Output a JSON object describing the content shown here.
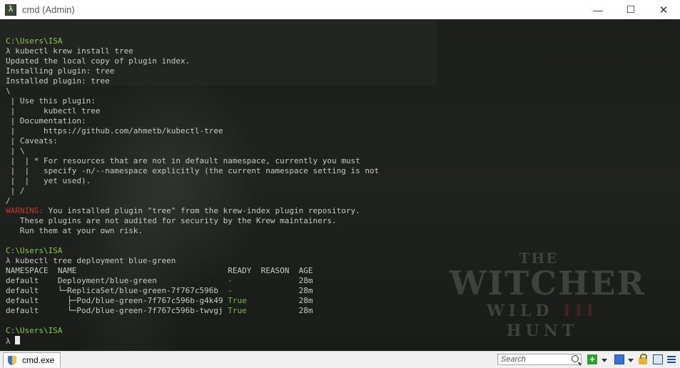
{
  "window": {
    "title": "cmd (Admin)",
    "app_icon": "cmder-icon",
    "controls": [
      "minimize",
      "maximize",
      "close"
    ]
  },
  "background": {
    "logo_the": "THE",
    "logo_main": "WITCHER",
    "logo_sub_left": "WILD",
    "logo_sub_numeral": "III",
    "logo_sub_right": "HUNT"
  },
  "terminal": {
    "lines": [
      {
        "segments": [
          {
            "t": "C:\\Users\\ISA",
            "c": "prompt"
          }
        ]
      },
      {
        "segments": [
          {
            "t": "λ kubectl krew install tree"
          }
        ]
      },
      {
        "segments": [
          {
            "t": "Updated the local copy of plugin index."
          }
        ]
      },
      {
        "segments": [
          {
            "t": "Installing plugin: tree"
          }
        ]
      },
      {
        "segments": [
          {
            "t": "Installed plugin: tree"
          }
        ]
      },
      {
        "segments": [
          {
            "t": "\\"
          }
        ]
      },
      {
        "segments": [
          {
            "t": " | Use this plugin:"
          }
        ]
      },
      {
        "segments": [
          {
            "t": " |      kubectl tree"
          }
        ]
      },
      {
        "segments": [
          {
            "t": " | Documentation:"
          }
        ]
      },
      {
        "segments": [
          {
            "t": " |      https://github.com/ahmetb/kubectl-tree"
          }
        ]
      },
      {
        "segments": [
          {
            "t": " | Caveats:"
          }
        ]
      },
      {
        "segments": [
          {
            "t": " | \\"
          }
        ]
      },
      {
        "segments": [
          {
            "t": " |  | * For resources that are not in default namespace, currently you must"
          }
        ]
      },
      {
        "segments": [
          {
            "t": " |  |   specify -n/--namespace explicitly (the current namespace setting is not"
          }
        ]
      },
      {
        "segments": [
          {
            "t": " |  |   yet used)."
          }
        ]
      },
      {
        "segments": [
          {
            "t": " | /"
          }
        ]
      },
      {
        "segments": [
          {
            "t": "/"
          }
        ]
      },
      {
        "segments": [
          {
            "t": "WARNING:",
            "c": "warn"
          },
          {
            "t": " You installed plugin \"tree\" from the krew-index plugin repository."
          }
        ]
      },
      {
        "segments": [
          {
            "t": "   These plugins are not audited for security by the Krew maintainers."
          }
        ]
      },
      {
        "segments": [
          {
            "t": "   Run them at your own risk."
          }
        ]
      },
      {
        "segments": [
          {
            "t": ""
          }
        ]
      },
      {
        "segments": [
          {
            "t": "C:\\Users\\ISA",
            "c": "prompt"
          }
        ]
      },
      {
        "segments": [
          {
            "t": "λ kubectl tree deployment blue-green"
          }
        ]
      },
      {
        "segments": [
          {
            "t": "NAMESPACE  NAME                                READY  REASON  AGE"
          }
        ]
      },
      {
        "segments": [
          {
            "t": "default    Deployment/blue-green               "
          },
          {
            "t": "-",
            "c": "dash"
          },
          {
            "t": "              28m"
          }
        ]
      },
      {
        "segments": [
          {
            "t": "default    └─ReplicaSet/blue-green-7f767c596b  "
          },
          {
            "t": "-",
            "c": "dash"
          },
          {
            "t": "              28m"
          }
        ]
      },
      {
        "segments": [
          {
            "t": "default      ├─Pod/blue-green-7f767c596b-g4k49 "
          },
          {
            "t": "True",
            "c": "true"
          },
          {
            "t": "           28m"
          }
        ]
      },
      {
        "segments": [
          {
            "t": "default      └─Pod/blue-green-7f767c596b-twvgj "
          },
          {
            "t": "True",
            "c": "true"
          },
          {
            "t": "           28m"
          }
        ]
      },
      {
        "segments": [
          {
            "t": ""
          }
        ]
      },
      {
        "segments": [
          {
            "t": "C:\\Users\\ISA",
            "c": "prompt"
          }
        ]
      },
      {
        "segments": [
          {
            "t": "λ "
          }
        ],
        "cursor": true
      }
    ]
  },
  "statusbar": {
    "tab_label": "cmd.exe",
    "search_placeholder": "Search",
    "icons": [
      "new-console-icon",
      "tabs-icon",
      "lock-icon",
      "panel-icon",
      "menu-icon"
    ]
  }
}
